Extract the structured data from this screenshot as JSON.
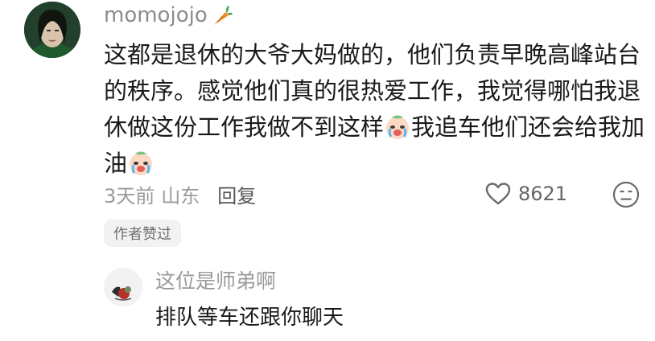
{
  "comment": {
    "username": "momojojo",
    "username_icon": "carrot-icon",
    "lines": [
      "这都是退休的大爷大妈做的，他们负责早晚高峰站台",
      "的秩序。感觉他们真的很热爱工作，我觉得哪怕我退",
      "休做这份工作我做不到这样",
      "我追车他们还会给我加",
      "油"
    ],
    "emoji": "crying-face-emoji",
    "time": "3天前",
    "location": "山东",
    "reply_label": "回复",
    "like_count": "8621",
    "badge": "作者赞过"
  },
  "reply": {
    "username": "这位是师弟啊",
    "text": "排队等车还跟你聊天"
  }
}
